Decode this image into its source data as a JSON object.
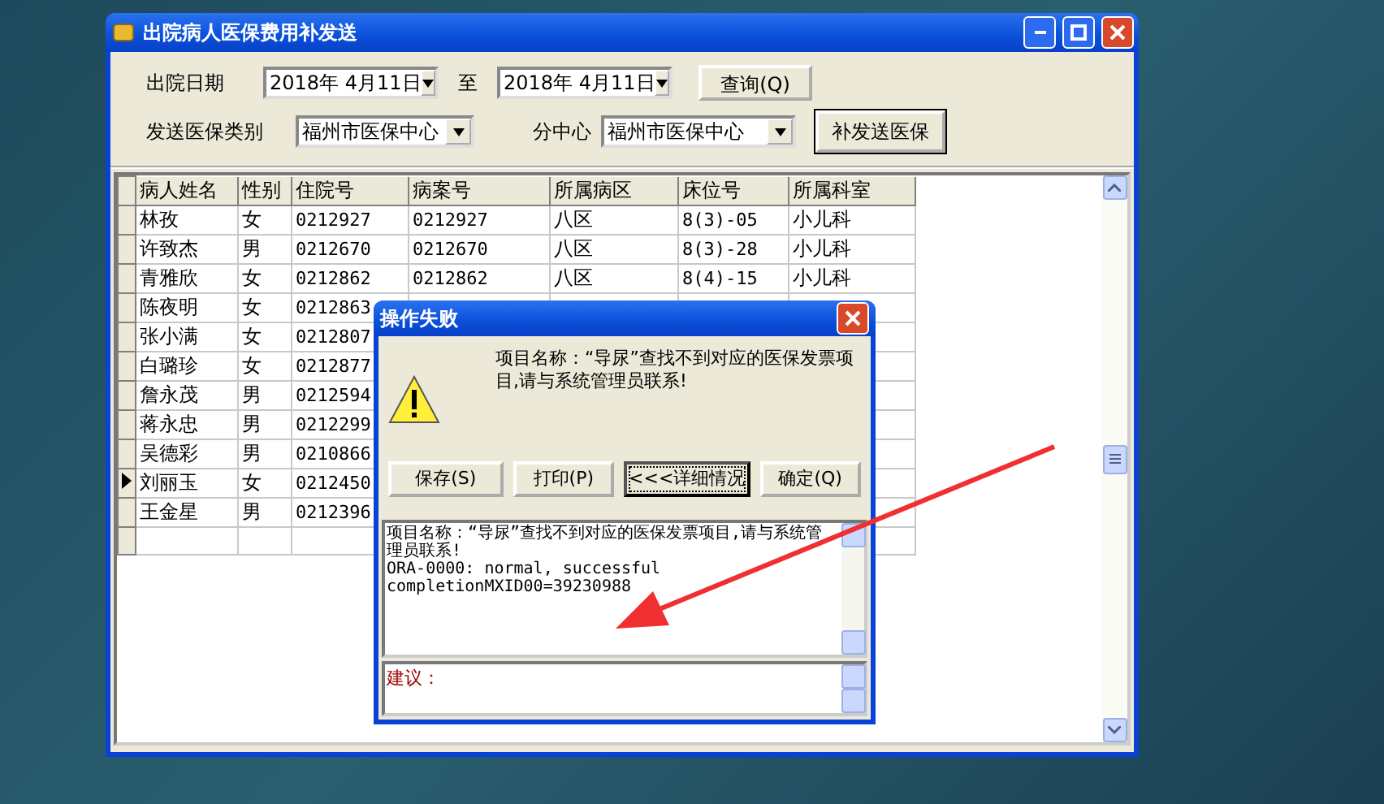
{
  "window": {
    "title": "出院病人医保费用补发送"
  },
  "filters": {
    "date_label": "出院日期",
    "date_from": "2018年  4月11日",
    "to_label": "至",
    "date_to": "2018年  4月11日",
    "query_button": "查询(Q)",
    "type_label": "发送医保类别",
    "type_value": "福州市医保中心",
    "center_label": "分中心",
    "center_value": "福州市医保中心",
    "resend_button": "补发送医保"
  },
  "table": {
    "columns": [
      "病人姓名",
      "性别",
      "住院号",
      "病案号",
      "所属病区",
      "床位号",
      "所属科室"
    ],
    "rows": [
      {
        "selected": false,
        "cells": [
          "林孜",
          "女",
          "0212927",
          "0212927",
          "八区",
          "8(3)-05",
          "小儿科"
        ]
      },
      {
        "selected": false,
        "cells": [
          "许致杰",
          "男",
          "0212670",
          "0212670",
          "八区",
          "8(3)-28",
          "小儿科"
        ]
      },
      {
        "selected": false,
        "cells": [
          "青雅欣",
          "女",
          "0212862",
          "0212862",
          "八区",
          "8(4)-15",
          "小儿科"
        ]
      },
      {
        "selected": false,
        "cells": [
          "陈夜明",
          "女",
          "0212863"
        ]
      },
      {
        "selected": false,
        "cells": [
          "张小满",
          "女",
          "0212807"
        ]
      },
      {
        "selected": false,
        "cells": [
          "白璐珍",
          "女",
          "0212877"
        ]
      },
      {
        "selected": false,
        "cells": [
          "詹永茂",
          "男",
          "0212594"
        ]
      },
      {
        "selected": false,
        "cells": [
          "蒋永忠",
          "男",
          "0212299"
        ]
      },
      {
        "selected": false,
        "cells": [
          "吴德彩",
          "男",
          "0210866"
        ]
      },
      {
        "selected": true,
        "cells": [
          "刘丽玉",
          "女",
          "0212450"
        ]
      },
      {
        "selected": false,
        "cells": [
          "王金星",
          "男",
          "0212396"
        ]
      }
    ]
  },
  "dialog": {
    "title": "操作失败",
    "message": "项目名称：“导尿”查找不到对应的医保发票项目,请与系统管理员联系!",
    "buttons": [
      {
        "label": "保存(S)",
        "focused": false
      },
      {
        "label": "打印(P)",
        "focused": false
      },
      {
        "label": "<<<详细情况",
        "focused": true
      },
      {
        "label": "确定(Q)",
        "focused": false
      }
    ],
    "details": "项目名称：“导尿”查找不到对应的医保发票项目,请与系统管理员联系!\nORA-0000: normal, successful\ncompletionMXID00=39230988",
    "suggestion": "建议："
  }
}
